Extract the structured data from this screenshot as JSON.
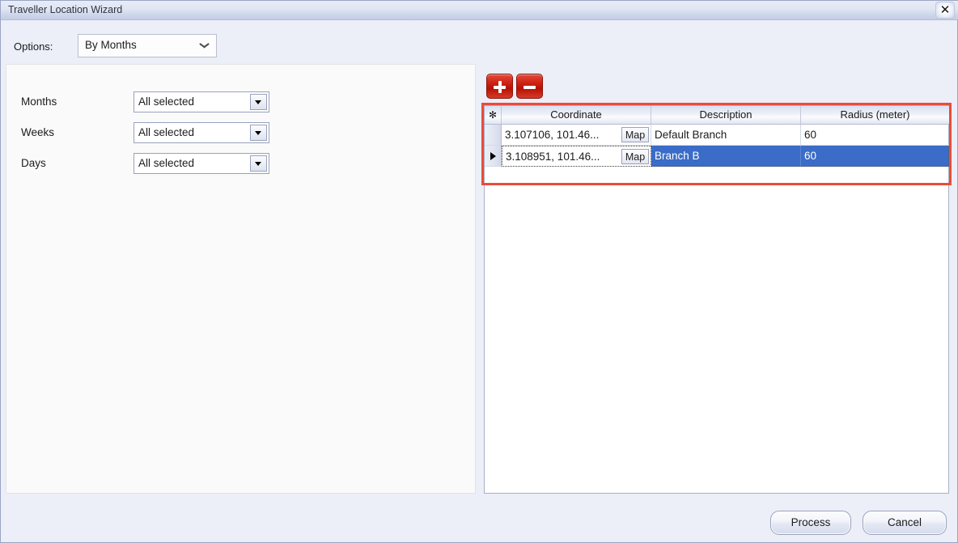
{
  "window": {
    "title": "Traveller Location Wizard",
    "close_icon": "close-icon",
    "close_glyph": "✕"
  },
  "options": {
    "label": "Options:",
    "selected": "By Months",
    "chevron_icon": "chevron-down-icon"
  },
  "filters": [
    {
      "label": "Months",
      "value": "All selected"
    },
    {
      "label": "Weeks",
      "value": "All selected"
    },
    {
      "label": "Days",
      "value": "All selected"
    }
  ],
  "toolbar": {
    "add_icon": "plus-icon",
    "remove_icon": "minus-icon"
  },
  "grid": {
    "row_selector_header": "✻",
    "columns": [
      "Coordinate",
      "Description",
      "Radius (meter)"
    ],
    "rows": [
      {
        "coordinate": "3.107106, 101.46...",
        "map_label": "Map",
        "description": "Default Branch",
        "radius": "60",
        "selected": false,
        "current": false
      },
      {
        "coordinate": "3.108951, 101.46...",
        "map_label": "Map",
        "description": "Branch B",
        "radius": "60",
        "selected": true,
        "current": true
      }
    ]
  },
  "footer": {
    "process_label": "Process",
    "cancel_label": "Cancel"
  },
  "colors": {
    "dialog_background": "#eceef8",
    "titlebar": "#d7deef",
    "accent_red": "#ea4c3a",
    "selection_blue": "#3a6cc8",
    "panel_white": "#fafafa"
  }
}
